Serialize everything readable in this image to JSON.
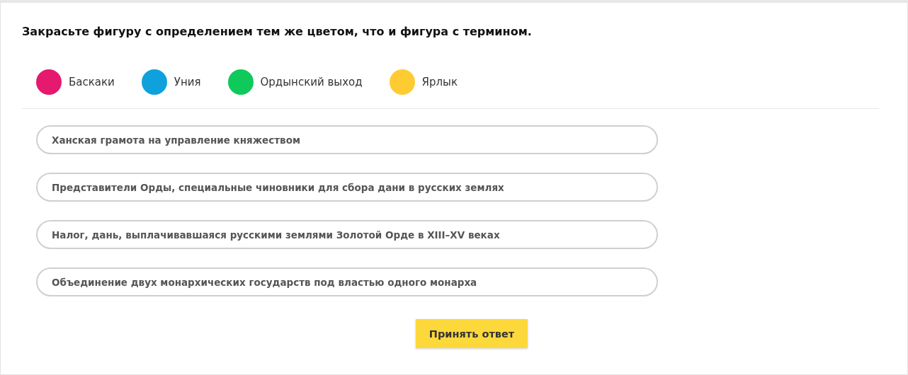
{
  "task": {
    "instruction": "Закрасьте фигуру с определением тем же цветом, что и фигура с термином."
  },
  "terms": [
    {
      "label": "Баскаки",
      "color": "#e5196e"
    },
    {
      "label": "Уния",
      "color": "#0ea1dc"
    },
    {
      "label": "Ордынский выход",
      "color": "#0fc95a"
    },
    {
      "label": "Ярлык",
      "color": "#ffcb32"
    }
  ],
  "definitions": [
    {
      "text": "Ханская грамота на управление княжеством"
    },
    {
      "text": "Представители Орды, специальные чиновники для сбора дани в русских землях"
    },
    {
      "text": "Налог, дань, выплачивавшаяся русскими землями Золотой Орде в XIII–XV веках"
    },
    {
      "text": "Объединение двух монархических государств под властью одного монарха"
    }
  ],
  "submit_button": {
    "label": "Принять ответ"
  }
}
